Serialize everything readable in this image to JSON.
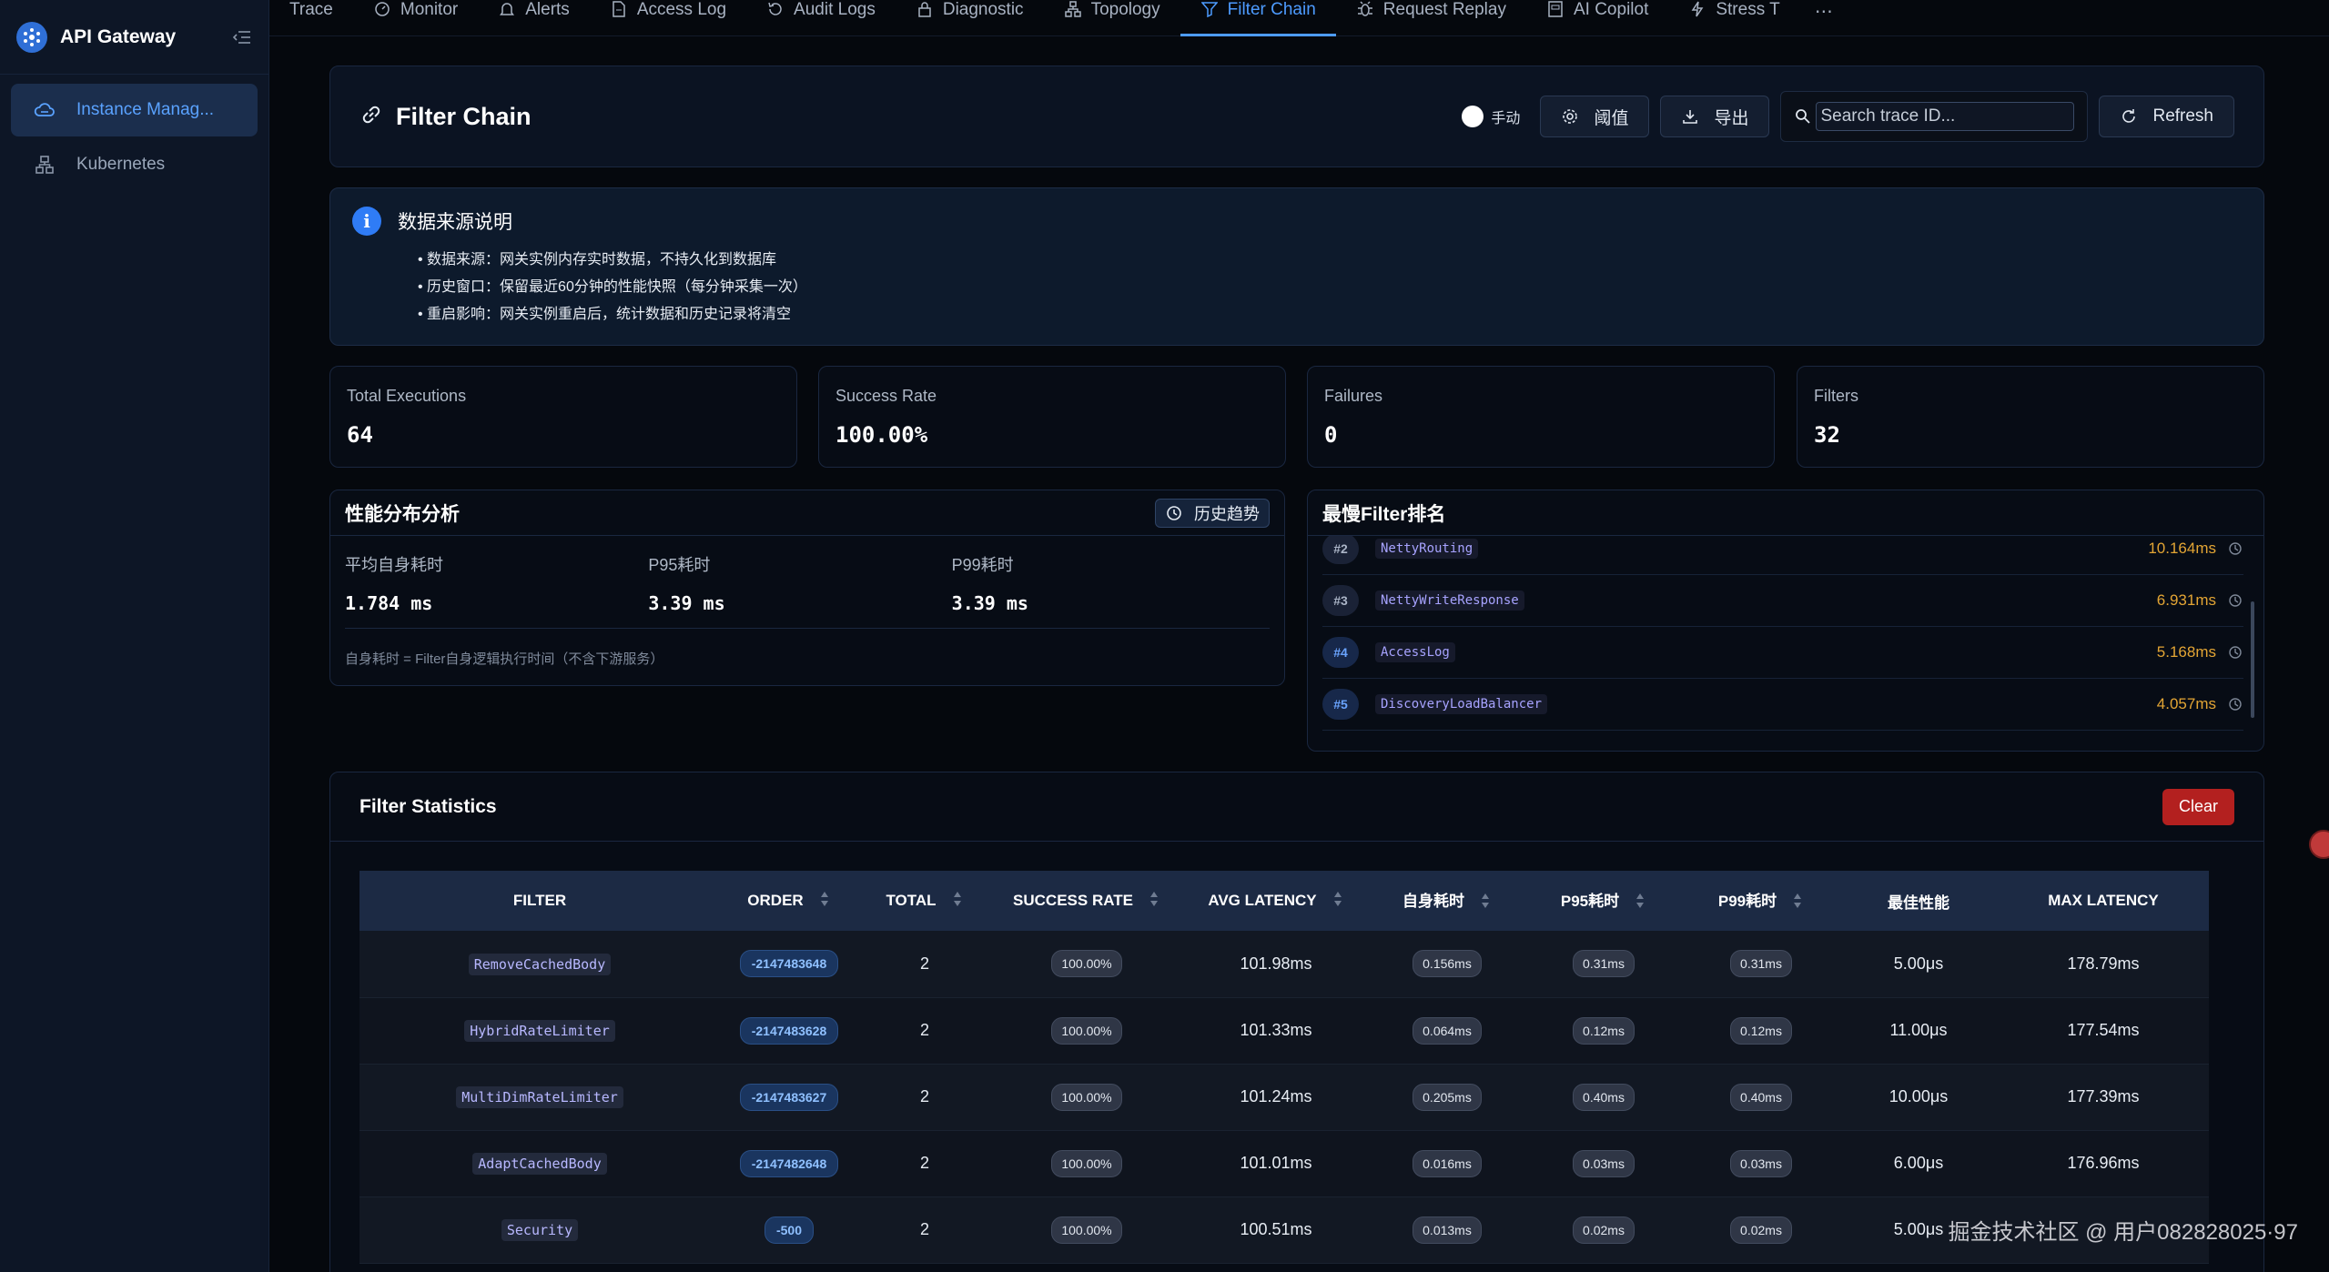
{
  "sidebar": {
    "brand": "API Gateway",
    "items": [
      {
        "label": "Instance Manag...",
        "icon": "cloud-icon",
        "active": true
      },
      {
        "label": "Kubernetes",
        "icon": "cluster-icon",
        "active": false
      }
    ]
  },
  "tabs": [
    {
      "label": "Trace",
      "icon": "",
      "active": false
    },
    {
      "label": "Monitor",
      "icon": "dashboard-icon",
      "active": false
    },
    {
      "label": "Alerts",
      "icon": "bell-icon",
      "active": false
    },
    {
      "label": "Access Log",
      "icon": "file-icon",
      "active": false
    },
    {
      "label": "Audit Logs",
      "icon": "history-icon",
      "active": false
    },
    {
      "label": "Diagnostic",
      "icon": "lock-icon",
      "active": false
    },
    {
      "label": "Topology",
      "icon": "topology-icon",
      "active": false
    },
    {
      "label": "Filter Chain",
      "icon": "filter-icon",
      "active": true
    },
    {
      "label": "Request Replay",
      "icon": "bug-icon",
      "active": false
    },
    {
      "label": "AI Copilot",
      "icon": "copilot-icon",
      "active": false
    },
    {
      "label": "Stress T",
      "icon": "bolt-icon",
      "active": false
    }
  ],
  "tabs_more": "⋯",
  "header": {
    "title": "Filter Chain",
    "toggle_label": "手动",
    "threshold_label": "阈值",
    "export_label": "导出",
    "search_placeholder": "Search trace ID...",
    "refresh_label": "Refresh"
  },
  "info": {
    "title": "数据来源说明",
    "lines": [
      "数据来源：网关实例内存实时数据，不持久化到数据库",
      "历史窗口：保留最近60分钟的性能快照（每分钟采集一次）",
      "重启影响：网关实例重启后，统计数据和历史记录将清空"
    ]
  },
  "stats": [
    {
      "label": "Total Executions",
      "value": "64"
    },
    {
      "label": "Success Rate",
      "value": "100.00%"
    },
    {
      "label": "Failures",
      "value": "0"
    },
    {
      "label": "Filters",
      "value": "32"
    }
  ],
  "perf": {
    "title": "性能分布分析",
    "history_btn": "历史趋势",
    "metrics": [
      {
        "label": "平均自身耗时",
        "value": "1.784 ms"
      },
      {
        "label": "P95耗时",
        "value": "3.39 ms"
      },
      {
        "label": "P99耗时",
        "value": "3.39 ms"
      }
    ],
    "note": "自身耗时 = Filter自身逻辑执行时间（不含下游服务）"
  },
  "slowest": {
    "title": "最慢Filter排名",
    "items": [
      {
        "rank": "#2",
        "name": "NettyRouting",
        "value": "10.164ms"
      },
      {
        "rank": "#3",
        "name": "NettyWriteResponse",
        "value": "6.931ms"
      },
      {
        "rank": "#4",
        "name": "AccessLog",
        "value": "5.168ms"
      },
      {
        "rank": "#5",
        "name": "DiscoveryLoadBalancer",
        "value": "4.057ms"
      }
    ]
  },
  "filter_stats": {
    "title": "Filter Statistics",
    "clear_label": "Clear",
    "columns": [
      "FILTER",
      "ORDER",
      "TOTAL",
      "SUCCESS RATE",
      "AVG LATENCY",
      "自身耗时",
      "P95耗时",
      "P99耗时",
      "最佳性能",
      "MAX LATENCY"
    ],
    "rows": [
      {
        "filter": "RemoveCachedBody",
        "order": "-2147483648",
        "total": "2",
        "success": "100.00%",
        "avg": "101.98ms",
        "self": "0.156ms",
        "p95": "0.31ms",
        "p99": "0.31ms",
        "best": "5.00μs",
        "max": "178.79ms"
      },
      {
        "filter": "HybridRateLimiter",
        "order": "-2147483628",
        "total": "2",
        "success": "100.00%",
        "avg": "101.33ms",
        "self": "0.064ms",
        "p95": "0.12ms",
        "p99": "0.12ms",
        "best": "11.00μs",
        "max": "177.54ms"
      },
      {
        "filter": "MultiDimRateLimiter",
        "order": "-2147483627",
        "total": "2",
        "success": "100.00%",
        "avg": "101.24ms",
        "self": "0.205ms",
        "p95": "0.40ms",
        "p99": "0.40ms",
        "best": "10.00μs",
        "max": "177.39ms"
      },
      {
        "filter": "AdaptCachedBody",
        "order": "-2147482648",
        "total": "2",
        "success": "100.00%",
        "avg": "101.01ms",
        "self": "0.016ms",
        "p95": "0.03ms",
        "p99": "0.03ms",
        "best": "6.00μs",
        "max": "176.96ms"
      },
      {
        "filter": "Security",
        "order": "-500",
        "total": "2",
        "success": "100.00%",
        "avg": "100.51ms",
        "self": "0.013ms",
        "p95": "0.02ms",
        "p99": "0.02ms",
        "best": "5.00μs",
        "max": ""
      }
    ]
  },
  "watermark": "掘金技术社区 @ 用户082828025·97"
}
